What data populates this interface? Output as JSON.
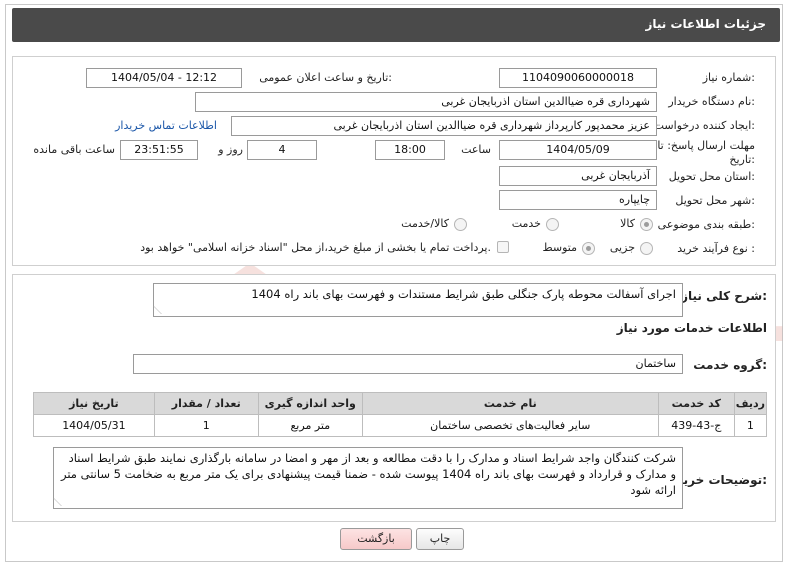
{
  "header": {
    "title": "جزئیات اطلاعات نیاز"
  },
  "form": {
    "need_number_label": "شماره نیاز:",
    "need_number": "1104090060000018",
    "announce_label": "تاریخ و ساعت اعلان عمومی:",
    "announce_value": "1404/05/04 - 12:12",
    "buyer_org_label": "نام دستگاه خریدار:",
    "buyer_org": "شهرداری قره ضیاالدین استان اذربایجان غربی",
    "requester_label": "ایجاد کننده درخواست:",
    "requester": "عزیز محمدپور کارپرداز شهرداری قره ضیاالدین استان اذربایجان غربی",
    "contact_link": "اطلاعات تماس خریدار",
    "deadline_label_1": "مهلت ارسال پاسخ: تا",
    "deadline_label_2": "تاریخ:",
    "deadline_date": "1404/05/09",
    "time_label": "ساعت",
    "deadline_time": "18:00",
    "days_value": "4",
    "days_label": "روز و",
    "remaining_time": "23:51:55",
    "remaining_label": "ساعت باقی مانده",
    "province_label": "استان محل تحویل:",
    "province": "آذربایجان غربی",
    "city_label": "شهر محل تحویل:",
    "city": "چایپاره",
    "category_label": "طبقه بندی موضوعی:",
    "category_options": [
      "کالا",
      "خدمت",
      "کالا/خدمت"
    ],
    "process_label": "نوع فرآیند خرید :",
    "process_options": [
      "جزیی",
      "متوسط"
    ],
    "payment_note": "پرداخت تمام یا بخشی از مبلغ خرید،از محل \"اسناد خزانه اسلامی\" خواهد بود."
  },
  "summary": {
    "label": "شرح کلی نیاز:",
    "text": "اجرای آسفالت محوطه پارک جنگلی طبق شرایط مستندات و فهرست بهای باند راه 1404"
  },
  "services": {
    "section_title": "اطلاعات خدمات مورد نیاز",
    "group_label": "گروه خدمت:",
    "group_value": "ساختمان",
    "columns": [
      "ردیف",
      "کد خدمت",
      "نام خدمت",
      "واحد اندازه گیری",
      "تعداد / مقدار",
      "تاریخ نیاز"
    ],
    "rows": [
      {
        "row": "1",
        "code": "ج-43-439",
        "name": "سایر فعالیت‌های تخصصی ساختمان",
        "unit": "متر مربع",
        "qty": "1",
        "date": "1404/05/31"
      }
    ]
  },
  "buyer_notes": {
    "label": "توضیحات خریدار:",
    "text": "شرکت کنندگان واجد شرایط اسناد و مدارک را با دقت مطالعه و بعد از مهر و امضا در سامانه بارگذاری نمایند طبق شرایط اسناد و مدارک  و قرارداد و فهرست بهای باند راه 1404 پیوست شده - ضمنا قیمت پیشنهادی برای یک متر مربع به ضخامت 5 سانتی متر ارائه شود"
  },
  "buttons": {
    "print": "چاپ",
    "back": "بازگشت"
  },
  "watermark": {
    "text": "AriaTender.neT"
  },
  "colors": {
    "header_bg": "#4a4a4a",
    "table_header_bg": "#d9d9d9",
    "link": "#1a56a8",
    "back_button": "#f6c9c9",
    "watermark": "#c94a3a"
  }
}
